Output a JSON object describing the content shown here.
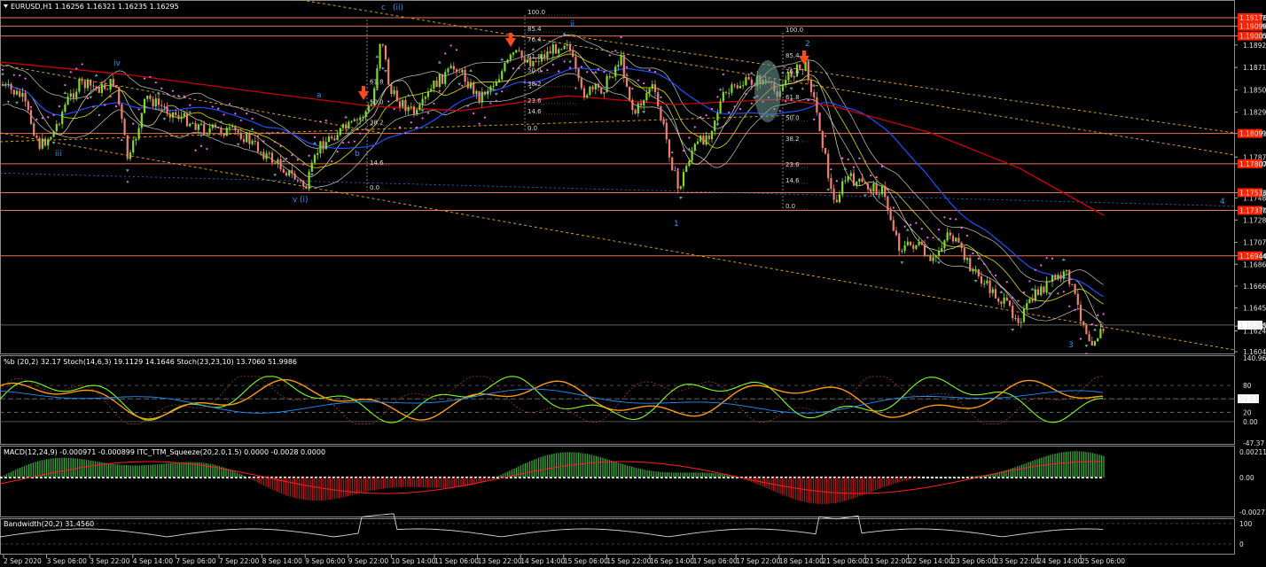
{
  "main": {
    "header": "EURUSD,H1  1.16256 1.16321 1.16235 1.16295",
    "price_labels": [
      "1.19176",
      "1.19096",
      "1.19005",
      "1.18920",
      "1.18710",
      "1.18500",
      "1.18290",
      "1.18091",
      "1.17870",
      "1.17807",
      "1.17536",
      "1.17485",
      "1.17370",
      "1.17280",
      "1.17070",
      "1.16944",
      "1.16865",
      "1.16660",
      "1.16455",
      "1.16285",
      "1.16240",
      "1.16045"
    ],
    "current_price": "1.16295",
    "level_tags": [
      "1.19176",
      "1.19096",
      "1.19005",
      "1.18091",
      "1.17807",
      "1.17536",
      "1.17370",
      "1.16944"
    ],
    "wave_labels": [
      "iii",
      "iv",
      "a",
      "b",
      "c",
      "(ii)",
      "v",
      "(i)",
      "ii",
      "1",
      "2",
      "3",
      "4"
    ],
    "fib1": [
      "61.8",
      "50.0",
      "38.2",
      "14.6",
      "0.0"
    ],
    "fib2": [
      "100.0",
      "85.4",
      "76.4",
      "61.8",
      "50.0",
      "38.2",
      "23.6",
      "14.6",
      "0.0"
    ],
    "fib3": [
      "100.0",
      "85.4",
      "76.4",
      "61.8",
      "50.0",
      "38.2",
      "23.6",
      "14.6",
      "0.0"
    ]
  },
  "stoch": {
    "header": "%b (20,2) 32.17  Stoch(14,6,3) 19.1129 14.1646  Stoch(23,23,10) 13.7060 51.9986",
    "scale": [
      "140.96",
      "80",
      "50.51",
      "0.00",
      "20",
      "-47.37"
    ]
  },
  "macd": {
    "header": "MACD(12,24,9) -0.000971 -0.000899  ITC_TTM_Squeeze(20,2.0,1.5) 0.0000 -0.0028 0.0000",
    "scale": [
      "0.002117",
      "0.00",
      "-0.00273"
    ]
  },
  "bw": {
    "header": "Bandwidth(20,2) 31.4560",
    "scale": [
      "100",
      "0"
    ]
  },
  "time_axis": [
    "2 Sep 2020",
    "3 Sep 06:00",
    "3 Sep 22:00",
    "4 Sep 14:00",
    "7 Sep 06:00",
    "7 Sep 22:00",
    "8 Sep 14:00",
    "9 Sep 06:00",
    "9 Sep 22:00",
    "10 Sep 14:00",
    "11 Sep 06:00",
    "13 Sep 22:00",
    "14 Sep 14:00",
    "15 Sep 06:00",
    "15 Sep 22:00",
    "16 Sep 14:00",
    "17 Sep 06:00",
    "17 Sep 22:00",
    "18 Sep 14:00",
    "21 Sep 06:00",
    "21 Sep 22:00",
    "22 Sep 14:00",
    "23 Sep 06:00",
    "23 Sep 22:00",
    "24 Sep 14:00",
    "25 Sep 06:00"
  ],
  "colors": {
    "bg": "#000000",
    "bull": "#7fdc2a",
    "bear": "#f08070",
    "level": "#e8735a",
    "sar": "#ff66ff",
    "ma_red": "#d00000",
    "ma_blue": "#1f4fff",
    "bands": "#b0b0b0",
    "channel": "#d4a017",
    "arrow": "#ff4a1a"
  }
}
